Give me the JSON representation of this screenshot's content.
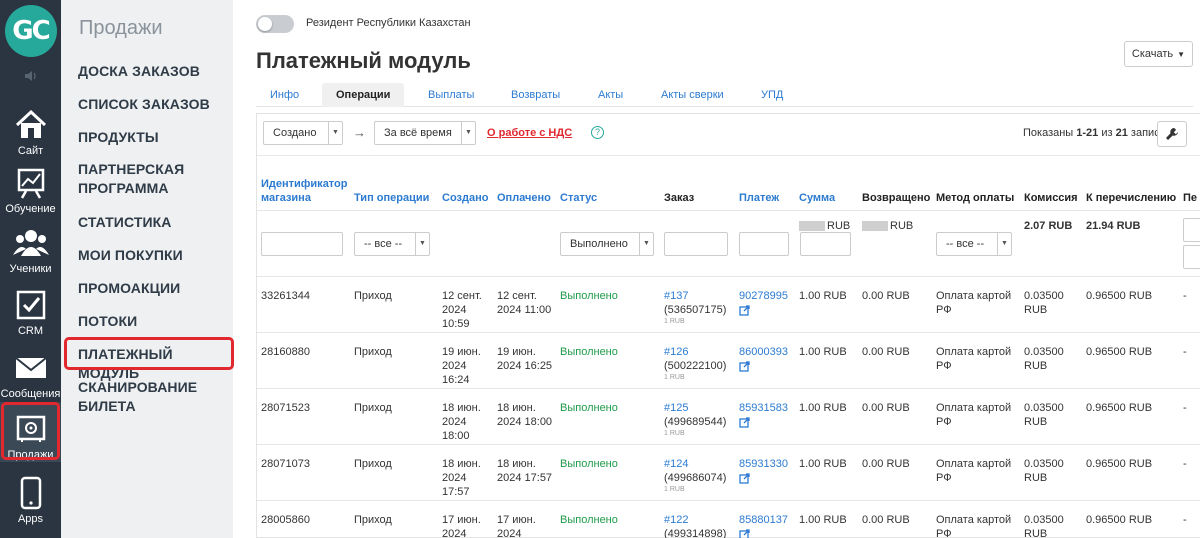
{
  "rail": {
    "logo": "GC",
    "items": [
      {
        "label": "Сайт",
        "icon": "house-icon"
      },
      {
        "label": "Обучение",
        "icon": "chart-board-icon"
      },
      {
        "label": "Ученики",
        "icon": "users-icon"
      },
      {
        "label": "CRM",
        "icon": "checkbox-icon"
      },
      {
        "label": "Сообщения",
        "icon": "envelope-icon"
      },
      {
        "label": "Продажи",
        "icon": "safe-icon"
      },
      {
        "label": "Apps",
        "icon": "phone-icon"
      }
    ]
  },
  "submenu": {
    "title": "Продажи",
    "items": [
      "ДОСКА ЗАКАЗОВ",
      "СПИСОК ЗАКАЗОВ",
      "ПРОДУКТЫ",
      "ПАРТНЕРСКАЯ ПРОГРАММА",
      "СТАТИСТИКА",
      "МОИ ПОКУПКИ",
      "ПРОМОАКЦИИ",
      "ПОТОКИ",
      "ПЛАТЕЖНЫЙ МОДУЛЬ",
      "СКАНИРОВАНИЕ БИЛЕТА"
    ]
  },
  "header": {
    "toggle_label": "Резидент Республики Казахстан",
    "title": "Платежный модуль",
    "download_label": "Скачать"
  },
  "tabs": [
    "Инфо",
    "Операции",
    "Выплаты",
    "Возвраты",
    "Акты",
    "Акты сверки",
    "УПД"
  ],
  "filters": {
    "created": "Создано",
    "period": "За всё время",
    "vat_link": "О работе с НДС",
    "help": "?",
    "shown_prefix": "Показаны ",
    "shown_range": "1-21",
    "shown_mid": " из ",
    "shown_total": "21",
    "shown_suffix": " запись."
  },
  "table": {
    "headers": {
      "shop_id": "Идентификатор магазина",
      "op_type": "Тип операции",
      "created": "Создано",
      "paid": "Оплачено",
      "status": "Статус",
      "order": "Заказ",
      "payment": "Платеж",
      "sum": "Сумма",
      "returned": "Возвращено",
      "method": "Метод оплаты",
      "commission": "Комиссия",
      "transfer": "К перечислению",
      "extra": "Пе"
    },
    "filter": {
      "op_type": "-- все --",
      "status": "Выполнено",
      "method": "-- все --"
    },
    "totals": {
      "sum": "RUB",
      "returned": "RUB",
      "commission": "2.07 RUB",
      "transfer": "21.94 RUB"
    },
    "rows": [
      {
        "shop_id": "33261344",
        "op_type": "Приход",
        "created": "12 сент. 2024 10:59",
        "paid": "12 сент. 2024 11:00",
        "status": "Выполнено",
        "order": "#137",
        "order_sub": "(536507175)",
        "order_small": "1 RUB",
        "payment": "90278995",
        "sum": "1.00 RUB",
        "returned": "0.00 RUB",
        "method": "Оплата картой РФ",
        "commission": "0.03500 RUB",
        "transfer": "0.96500 RUB",
        "extra": "-"
      },
      {
        "shop_id": "28160880",
        "op_type": "Приход",
        "created": "19 июн. 2024 16:24",
        "paid": "19 июн. 2024 16:25",
        "status": "Выполнено",
        "order": "#126",
        "order_sub": "(500222100)",
        "order_small": "1 RUB",
        "payment": "86000393",
        "sum": "1.00 RUB",
        "returned": "0.00 RUB",
        "method": "Оплата картой РФ",
        "commission": "0.03500 RUB",
        "transfer": "0.96500 RUB",
        "extra": "-"
      },
      {
        "shop_id": "28071523",
        "op_type": "Приход",
        "created": "18 июн. 2024 18:00",
        "paid": "18 июн. 2024 18:00",
        "status": "Выполнено",
        "order": "#125",
        "order_sub": "(499689544)",
        "order_small": "1 RUB",
        "payment": "85931583",
        "sum": "1.00 RUB",
        "returned": "0.00 RUB",
        "method": "Оплата картой РФ",
        "commission": "0.03500 RUB",
        "transfer": "0.96500 RUB",
        "extra": "-"
      },
      {
        "shop_id": "28071073",
        "op_type": "Приход",
        "created": "18 июн. 2024 17:57",
        "paid": "18 июн. 2024 17:57",
        "status": "Выполнено",
        "order": "#124",
        "order_sub": "(499686074)",
        "order_small": "1 RUB",
        "payment": "85931330",
        "sum": "1.00 RUB",
        "returned": "0.00 RUB",
        "method": "Оплата картой РФ",
        "commission": "0.03500 RUB",
        "transfer": "0.96500 RUB",
        "extra": "-"
      },
      {
        "shop_id": "28005860",
        "op_type": "Приход",
        "created": "17 июн. 2024",
        "paid": "17 июн. 2024",
        "status": "Выполнено",
        "order": "#122",
        "order_sub": "(499314898)",
        "order_small": "",
        "payment": "85880137",
        "sum": "1.00 RUB",
        "returned": "0.00 RUB",
        "method": "Оплата картой РФ",
        "commission": "0.03500 RUB",
        "transfer": "0.96500 RUB",
        "extra": "-"
      }
    ]
  }
}
